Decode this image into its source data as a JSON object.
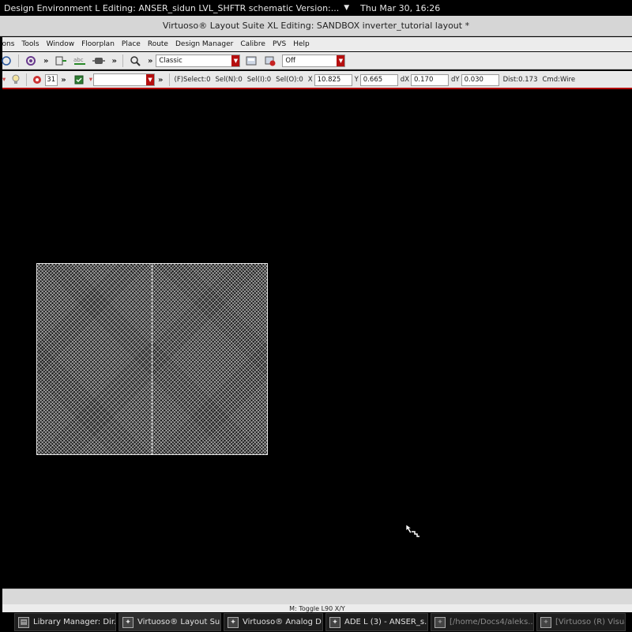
{
  "system_bar": {
    "window_title": "Design Environment L Editing: ANSER_sidun LVL_SHFTR schematic Version:...",
    "arrow": "▼",
    "datetime": "Thu Mar 30, 16:26"
  },
  "window": {
    "title": "Virtuoso® Layout Suite XL Editing: SANDBOX inverter_tutorial layout *"
  },
  "menu": [
    "ions",
    "Tools",
    "Window",
    "Floorplan",
    "Place",
    "Route",
    "Design Manager",
    "Calibre",
    "PVS",
    "Help"
  ],
  "toolbar1": {
    "chevron": "»",
    "workspace_value": "Classic",
    "mode_value": "Off"
  },
  "toolbar2": {
    "chevron": "»",
    "spin_value": "31",
    "selector_value": "",
    "f_select": "(F)Select:0",
    "sel_n": "Sel(N):0",
    "sel_i": "Sel(I):0",
    "sel_o": "Sel(O):0",
    "x_label": "X",
    "x_value": "10.825",
    "y_label": "Y",
    "y_value": "0.665",
    "dx_label": "dX",
    "dx_value": "0.170",
    "dy_label": "dY",
    "dy_value": "0.030",
    "dist": "Dist:0.173",
    "cmd": "Cmd:Wire"
  },
  "status": {
    "message": "M: Toggle L90 X/Y"
  },
  "taskbar": [
    {
      "label": "Library Manager: Dir...",
      "icon": "book-icon"
    },
    {
      "label": "Virtuoso® Layout Su...",
      "icon": "virtuoso-icon",
      "active": true
    },
    {
      "label": "Virtuoso® Analog D...",
      "icon": "virtuoso-icon"
    },
    {
      "label": "ADE L (3) - ANSER_s...",
      "icon": "virtuoso-icon"
    },
    {
      "label": "[/home/Docs4/aleks...",
      "icon": "virtuoso-icon",
      "dim": true
    },
    {
      "label": "[Virtuoso (R) Visuali",
      "icon": "virtuoso-icon",
      "dim": true
    }
  ],
  "colors": {
    "accent_red": "#b50f0f",
    "canvas": "#000000"
  }
}
